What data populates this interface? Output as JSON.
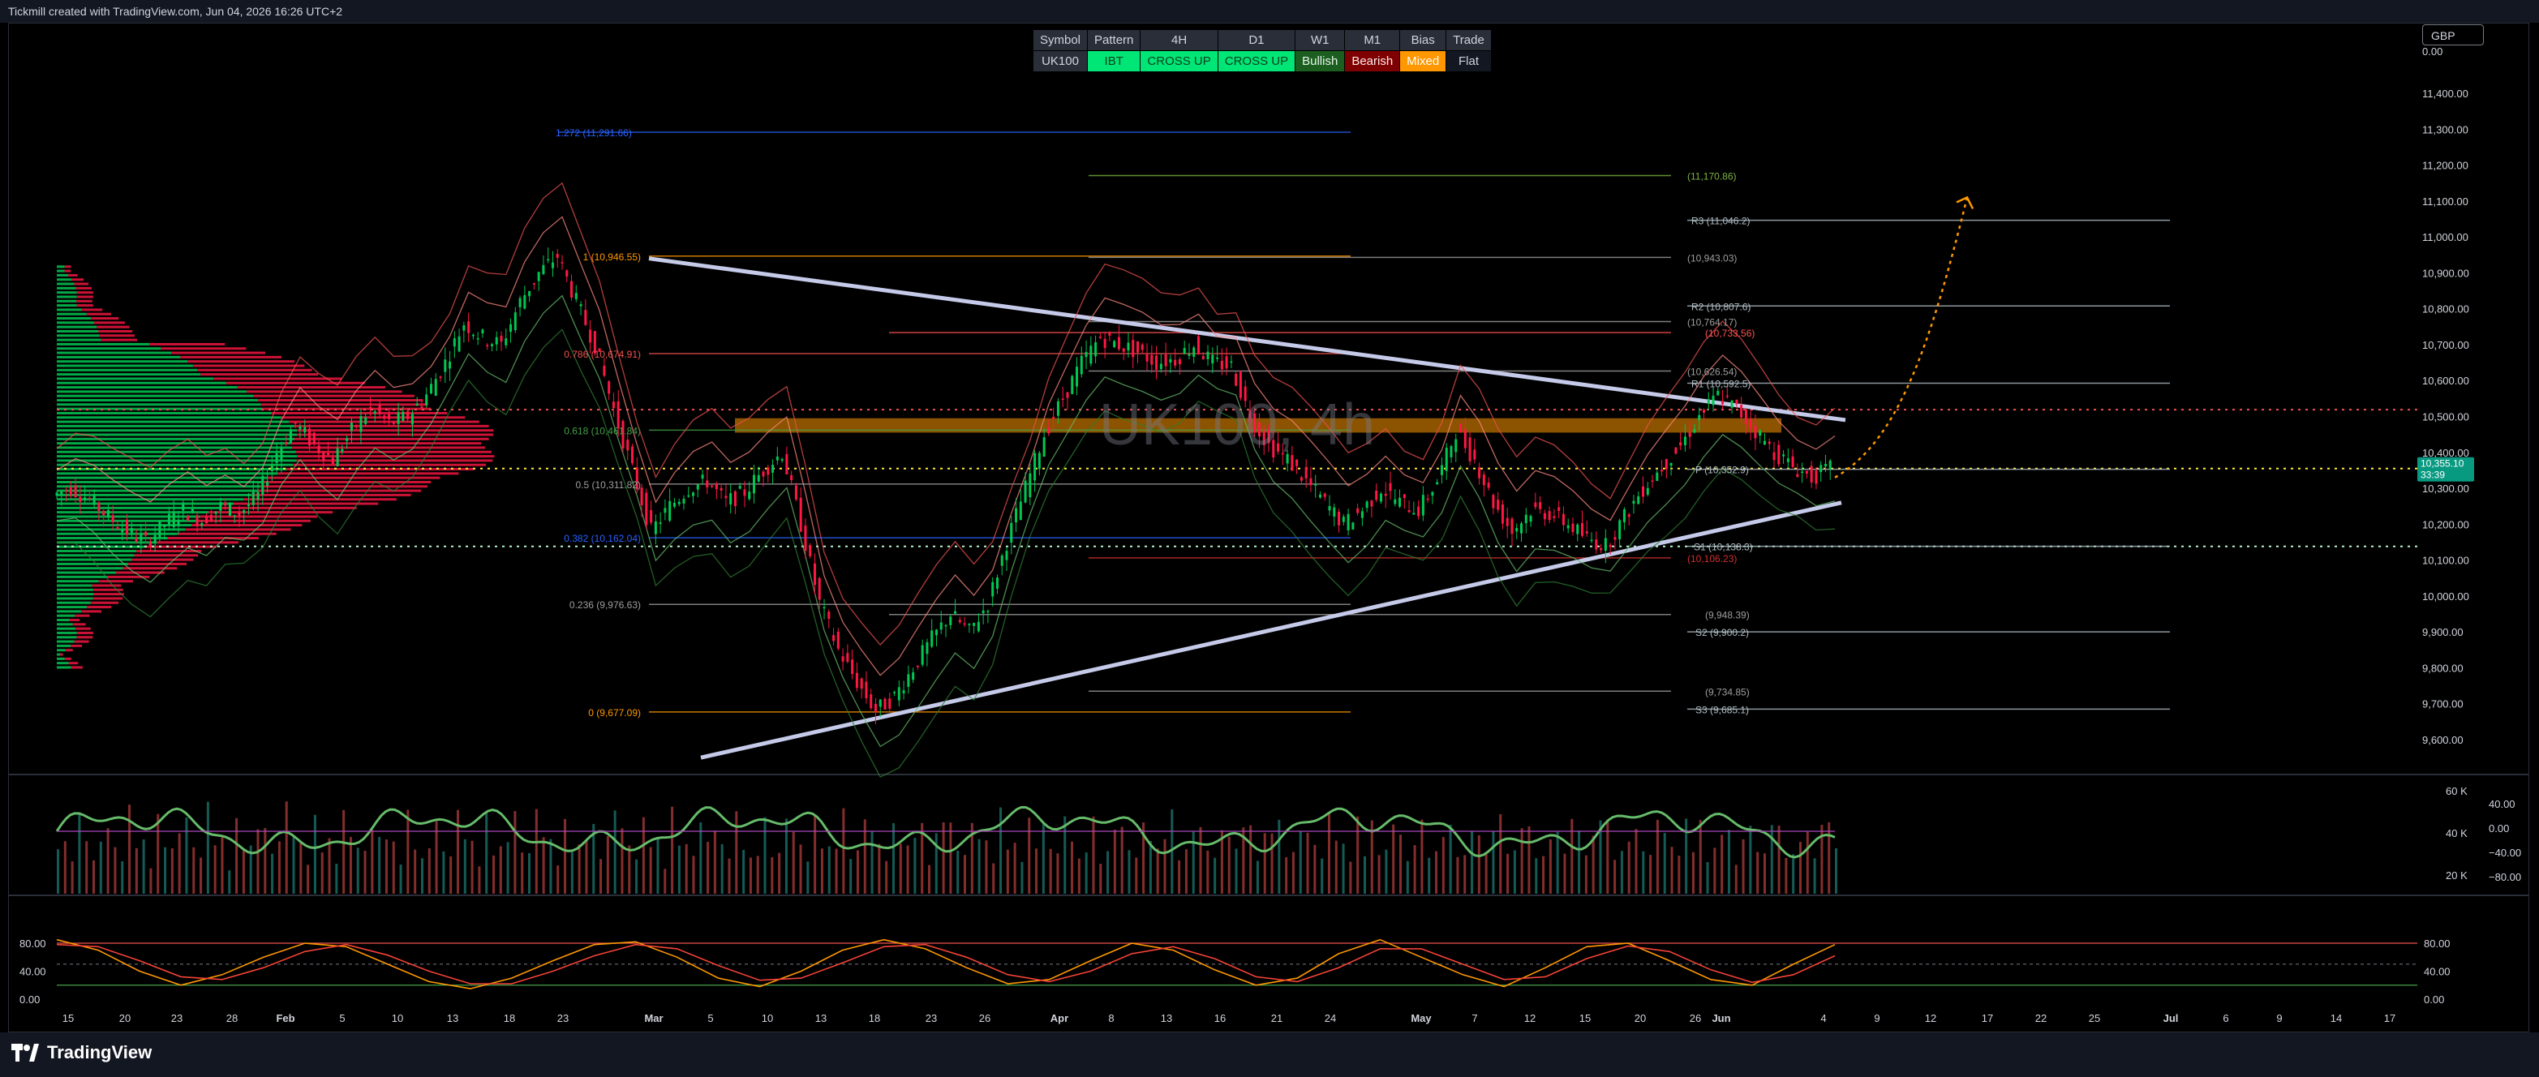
{
  "header": {
    "credit": "Tickmill created with TradingView.com, Jun 04, 2026 16:26 UTC+2",
    "currency": "GBP"
  },
  "watermark": "UK100, 4h",
  "summary_table": {
    "headers": [
      "Symbol",
      "Pattern",
      "4H",
      "D1",
      "W1",
      "M1",
      "Bias",
      "Trade"
    ],
    "row": [
      "UK100",
      "IBT",
      "CROSS UP",
      "CROSS UP",
      "Bullish",
      "Bearish",
      "Mixed",
      "Flat"
    ]
  },
  "colors": {
    "up": "#26a69a",
    "down": "#ef5350",
    "candle_up": "#00c853",
    "candle_down": "#ff1744",
    "trendline": "#c5cae9",
    "fib": "#ff9800",
    "fib_blue": "#2962ff",
    "price_badge": "#089981"
  },
  "chart_data": [
    {
      "type": "line",
      "panel": "price",
      "title": "UK100, 4h",
      "ylim": [
        9500,
        11500
      ],
      "y_ticks": [
        "11,400.00",
        "11,300.00",
        "11,200.00",
        "11,100.00",
        "11,000.00",
        "10,900.00",
        "10,800.00",
        "10,700.00",
        "10,600.00",
        "10,500.00",
        "10,400.00",
        "10,300.00",
        "10,200.00",
        "10,100.00",
        "10,000.00",
        "9,900.00",
        "9,800.00",
        "9,700.00",
        "9,600.00"
      ],
      "y_tick_values": [
        11400,
        11300,
        11200,
        11100,
        11000,
        10900,
        10800,
        10700,
        10600,
        10500,
        10400,
        10300,
        10200,
        10100,
        10000,
        9900,
        9800,
        9700,
        9600
      ],
      "top_tick": "0.00",
      "x_ticks": [
        "15",
        "20",
        "23",
        "28",
        "Feb",
        "5",
        "10",
        "13",
        "18",
        "23",
        "Mar",
        "5",
        "10",
        "13",
        "18",
        "23",
        "26",
        "Apr",
        "8",
        "13",
        "16",
        "21",
        "24",
        "May",
        "7",
        "12",
        "15",
        "20",
        "26",
        "Jun",
        "4",
        "9",
        "12",
        "17",
        "22",
        "25",
        "Jul",
        "6",
        "9",
        "14",
        "17"
      ],
      "x_range": [
        "Jan 15",
        "Jul 17"
      ],
      "series": [
        {
          "values": [
            10280,
            10300,
            10270,
            10220,
            10180,
            10150,
            10200,
            10240,
            10210,
            10250,
            10230,
            10280,
            10400,
            10480,
            10420,
            10380,
            10460,
            10520,
            10480,
            10500,
            10560,
            10650,
            10760,
            10720,
            10700,
            10820,
            10900,
            10946,
            10820,
            10700,
            10520,
            10350,
            10180,
            10250,
            10300,
            10320,
            10260,
            10290,
            10350,
            10400,
            10200,
            9980,
            9850,
            9760,
            9680,
            9720,
            9800,
            9880,
            9950,
            9900,
            9980,
            10150,
            10300,
            10450,
            10550,
            10650,
            10720,
            10700,
            10680,
            10650,
            10660,
            10700,
            10650,
            10640,
            10500,
            10420,
            10380,
            10320,
            10260,
            10200,
            10240,
            10300,
            10260,
            10240,
            10320,
            10460,
            10380,
            10260,
            10180,
            10240,
            10230,
            10200,
            10160,
            10140,
            10220,
            10300,
            10360,
            10420,
            10500,
            10560,
            10520,
            10460,
            10400,
            10360,
            10330,
            10355
          ]
        }
      ],
      "price_labels": [
        {
          "text": "1.272 (11,291.66)",
          "value": 11291.66
        },
        {
          "text": "(11,170.86)",
          "value": 11170.86
        },
        {
          "text": "R3 (11,046.2)",
          "value": 11046.2
        },
        {
          "text": "1 (10,946.55)",
          "value": 10946.55
        },
        {
          "text": "(10,943.03)",
          "value": 10943.03
        },
        {
          "text": "R2 (10,807.6)",
          "value": 10807.6
        },
        {
          "text": "(10,764.17)",
          "value": 10764.17
        },
        {
          "text": "(10,733.56)",
          "value": 10733.56
        },
        {
          "text": "0.786 (10,674.91)",
          "value": 10674.91
        },
        {
          "text": "(10,626.54)",
          "value": 10626.54
        },
        {
          "text": "R1 (10,592.5)",
          "value": 10592.5
        },
        {
          "text": "0.618 (10,461.84)",
          "value": 10461.84
        },
        {
          "text": "P (10,352.9)",
          "value": 10352.9
        },
        {
          "text": "0.5 (10,311.82)",
          "value": 10311.82
        },
        {
          "text": "0.382 (10,162.04)",
          "value": 10162.04
        },
        {
          "text": "S1 (10,138.3)",
          "value": 10138.3
        },
        {
          "text": "(10,106.23)",
          "value": 10106.23
        },
        {
          "text": "0.236 (9,976.63)",
          "value": 9976.63
        },
        {
          "text": "(9,948.39)",
          "value": 9948.39
        },
        {
          "text": "S2 (9,900.2)",
          "value": 9900.2
        },
        {
          "text": "(9,734.85)",
          "value": 9734.85
        },
        {
          "text": "S3 (9,685.1)",
          "value": 9685.1
        },
        {
          "text": "0 (9,677.09)",
          "value": 9677.09
        }
      ],
      "last_price": {
        "value": "10,355.10",
        "countdown": "33:39"
      }
    },
    {
      "type": "bar",
      "panel": "volume_momentum",
      "y_ticks_left": [
        "60 K",
        "40 K",
        "20 K"
      ],
      "y_ticks_right": [
        "40.00",
        "0.00",
        "−40.00",
        "−80.00"
      ],
      "ylim_volume": [
        0,
        70000
      ],
      "values": [
        45000,
        32000,
        28000,
        51000,
        40000,
        22000,
        36000,
        47000,
        30000,
        26000,
        55000,
        42000,
        33000,
        24000,
        49000,
        38000,
        29000,
        44000,
        52000,
        31000,
        27000,
        58000,
        41000,
        35000,
        23000,
        46000,
        39000,
        30000,
        50000,
        43000,
        28000,
        37000,
        60000,
        45000,
        32000,
        26000,
        48000,
        40000,
        34000,
        25000,
        53000,
        42000,
        31000,
        29000,
        47000,
        36000
      ]
    },
    {
      "type": "line",
      "panel": "stochastic",
      "ylim": [
        0,
        100
      ],
      "y_ticks": [
        "80.00",
        "40.00",
        "0.00"
      ],
      "series": [
        {
          "values": [
            85,
            70,
            40,
            20,
            35,
            60,
            80,
            75,
            50,
            25,
            15,
            30,
            55,
            78,
            82,
            60,
            30,
            18,
            40,
            70,
            85,
            72,
            45,
            22,
            28,
            55,
            80,
            70,
            42,
            20,
            30,
            65,
            85,
            60,
            35,
            18,
            45,
            75,
            80,
            55,
            28,
            20,
            50,
            78
          ]
        },
        {
          "values": [
            78,
            75,
            55,
            32,
            28,
            45,
            68,
            78,
            63,
            40,
            22,
            22,
            40,
            62,
            78,
            72,
            48,
            27,
            30,
            52,
            75,
            78,
            60,
            35,
            25,
            40,
            65,
            75,
            58,
            32,
            25,
            45,
            72,
            72,
            50,
            28,
            32,
            58,
            76,
            68,
            42,
            24,
            35,
            62
          ]
        }
      ]
    }
  ]
}
